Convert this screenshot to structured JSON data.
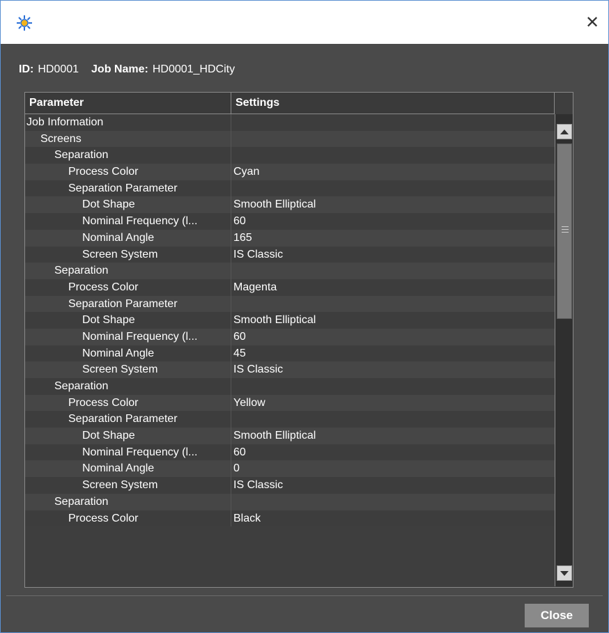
{
  "dialog": {
    "icon": "sun-gear-icon",
    "close_glyph": "✕"
  },
  "header": {
    "id_label": "ID:",
    "id_value": "HD0001",
    "job_label": "Job Name:",
    "job_value": "HD0001_HDCity"
  },
  "table": {
    "columns": [
      "Parameter",
      "Settings"
    ],
    "rows": [
      {
        "param": "Job Information",
        "indent": 0,
        "setting": ""
      },
      {
        "param": "Screens",
        "indent": 1,
        "setting": ""
      },
      {
        "param": "Separation",
        "indent": 2,
        "setting": ""
      },
      {
        "param": "Process Color",
        "indent": 3,
        "setting": "Cyan"
      },
      {
        "param": "Separation Parameter",
        "indent": 3,
        "setting": ""
      },
      {
        "param": "Dot Shape",
        "indent": 4,
        "setting": "Smooth Elliptical"
      },
      {
        "param": "Nominal Frequency (l...",
        "indent": 4,
        "setting": "60"
      },
      {
        "param": "Nominal Angle",
        "indent": 4,
        "setting": "165"
      },
      {
        "param": "Screen System",
        "indent": 4,
        "setting": "IS Classic"
      },
      {
        "param": "Separation",
        "indent": 2,
        "setting": ""
      },
      {
        "param": "Process Color",
        "indent": 3,
        "setting": "Magenta"
      },
      {
        "param": "Separation Parameter",
        "indent": 3,
        "setting": ""
      },
      {
        "param": "Dot Shape",
        "indent": 4,
        "setting": "Smooth Elliptical"
      },
      {
        "param": "Nominal Frequency (l...",
        "indent": 4,
        "setting": "60"
      },
      {
        "param": "Nominal Angle",
        "indent": 4,
        "setting": "45"
      },
      {
        "param": "Screen System",
        "indent": 4,
        "setting": "IS Classic"
      },
      {
        "param": "Separation",
        "indent": 2,
        "setting": ""
      },
      {
        "param": "Process Color",
        "indent": 3,
        "setting": "Yellow"
      },
      {
        "param": "Separation Parameter",
        "indent": 3,
        "setting": ""
      },
      {
        "param": "Dot Shape",
        "indent": 4,
        "setting": "Smooth Elliptical"
      },
      {
        "param": "Nominal Frequency (l...",
        "indent": 4,
        "setting": "60"
      },
      {
        "param": "Nominal Angle",
        "indent": 4,
        "setting": "0"
      },
      {
        "param": "Screen System",
        "indent": 4,
        "setting": "IS Classic"
      },
      {
        "param": "Separation",
        "indent": 2,
        "setting": ""
      },
      {
        "param": "Process Color",
        "indent": 3,
        "setting": "Black"
      }
    ]
  },
  "footer": {
    "close_label": "Close"
  },
  "colors": {
    "background": "#4a4a4a",
    "row_odd": "#3d3d3d",
    "row_even": "#464646",
    "button": "#8a8a8a",
    "text": "#ffffff"
  }
}
